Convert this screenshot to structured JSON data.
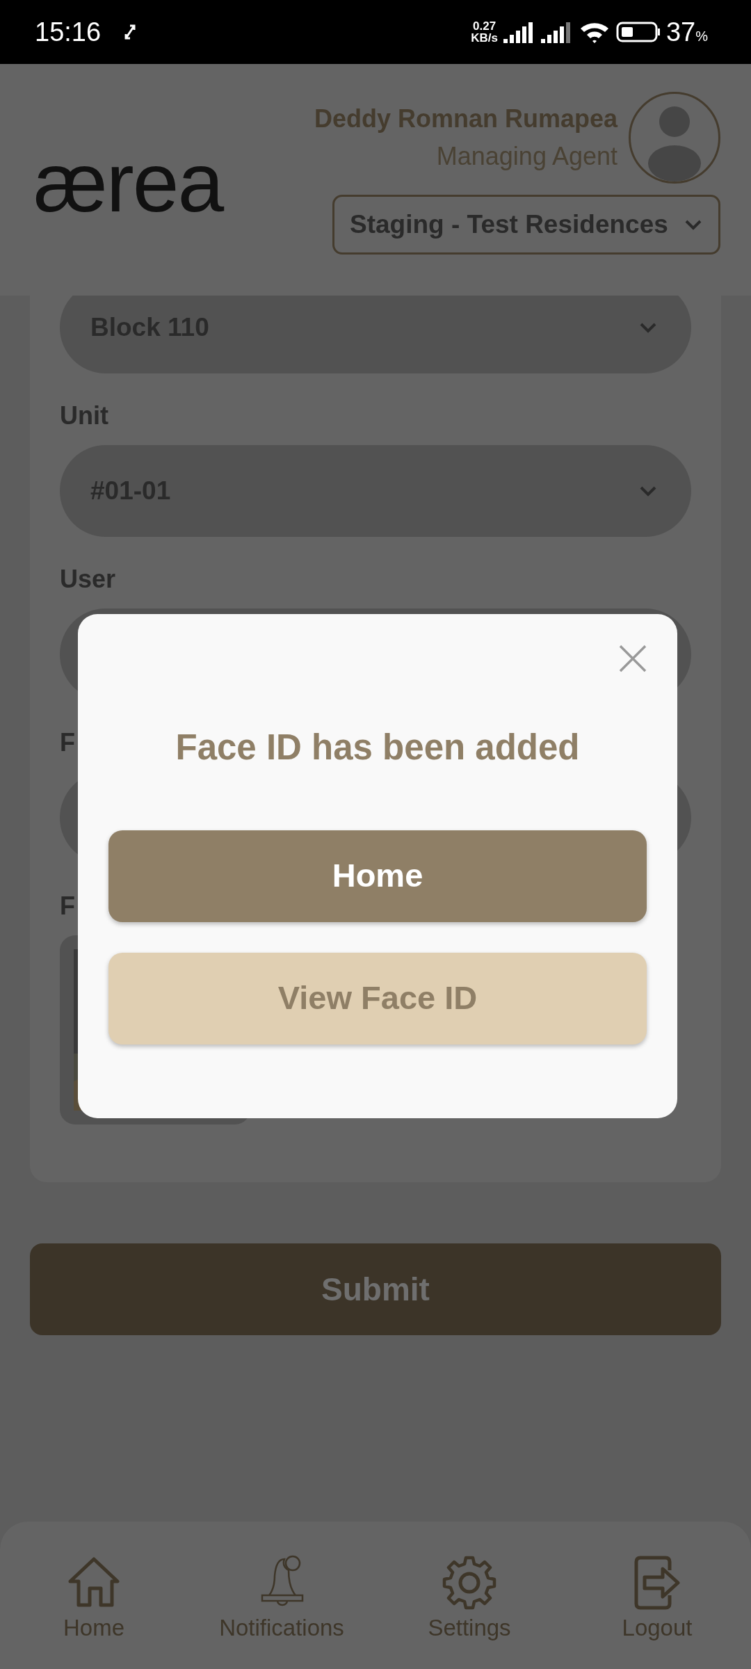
{
  "status_bar": {
    "time": "15:16",
    "speed_value": "0.27",
    "speed_unit": "KB/s",
    "battery": "37",
    "battery_unit": "%"
  },
  "header": {
    "logo": "ærea",
    "user_name": "Deddy Romnan Rumapea",
    "user_role": "Managing Agent",
    "property": "Staging - Test Residences"
  },
  "form": {
    "fields": [
      {
        "kind": "select",
        "value": "Block 110"
      },
      {
        "kind": "select",
        "label": "Unit",
        "value": "#01-01"
      },
      {
        "kind": "select",
        "label": "User"
      },
      {
        "kind": "select",
        "label": "F"
      },
      {
        "label": "F"
      }
    ]
  },
  "submit": "Submit",
  "dialog": {
    "title": "Face ID has been added",
    "buttons": [
      {
        "label": "Home",
        "kind": "primary"
      },
      {
        "label": "View Face ID",
        "kind": "secondary"
      }
    ]
  },
  "nav": [
    {
      "label": "Home"
    },
    {
      "label": "Notifications"
    },
    {
      "label": "Settings"
    },
    {
      "label": "Logout"
    }
  ]
}
